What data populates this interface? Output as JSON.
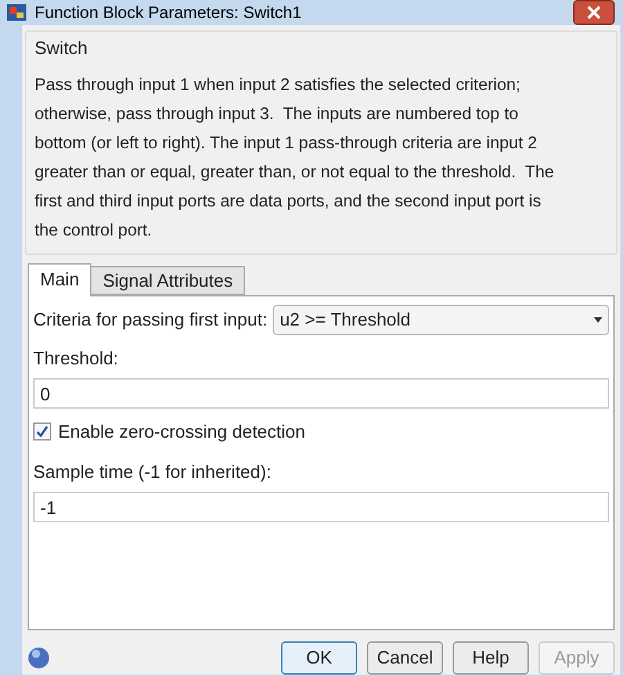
{
  "window": {
    "title": "Function Block Parameters: Switch1"
  },
  "group": {
    "title": "Switch",
    "description": "Pass through input 1 when input 2 satisfies the selected criterion; otherwise, pass through input 3.  The inputs are numbered top to bottom (or left to right). The input 1 pass-through criteria are input 2 greater than or equal, greater than, or not equal to the threshold.  The first and third input ports are data ports, and the second input port is the control port."
  },
  "tabs": [
    {
      "label": "Main",
      "selected": true
    },
    {
      "label": "Signal Attributes",
      "selected": false
    }
  ],
  "params": [
    {
      "kind": "dropdown",
      "label": "Criteria for passing first input:",
      "value": "u2 >= Threshold"
    },
    {
      "kind": "field",
      "label": "Threshold:",
      "value": "0"
    },
    {
      "kind": "checkbox",
      "label": "Enable zero-crossing detection",
      "checked": true
    },
    {
      "kind": "field",
      "label": "Sample time (-1 for inherited):",
      "value": "-1"
    }
  ],
  "buttons": [
    {
      "label": "OK",
      "disabled": false,
      "default": true
    },
    {
      "label": "Cancel",
      "disabled": false,
      "default": false
    },
    {
      "label": "Help",
      "disabled": false,
      "default": false
    },
    {
      "label": "Apply",
      "disabled": true,
      "default": false
    }
  ]
}
